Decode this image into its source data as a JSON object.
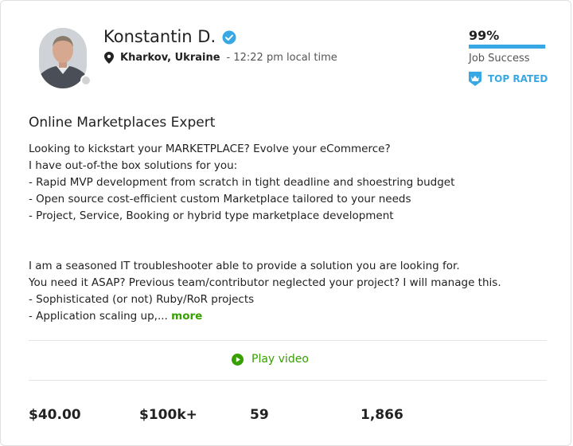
{
  "profile": {
    "name": "Konstantin D.",
    "location": "Kharkov, Ukraine",
    "local_time": "- 12:22 pm local time",
    "title": "Online Marketplaces Expert"
  },
  "job_success": {
    "percent_label": "99%",
    "value": 99,
    "label": "Job Success"
  },
  "badge": {
    "label": "TOP RATED"
  },
  "description": {
    "lines": [
      "Looking to kickstart your MARKETPLACE? Evolve your eCommerce?",
      "I have out-of-the box solutions for you:",
      "- Rapid MVP development from scratch in tight deadline and shoestring budget",
      "- Open source cost-efficient custom Marketplace tailored to your needs",
      "- Project, Service, Booking or hybrid type marketplace development",
      "I am a seasoned IT troubleshooter able to provide a solution you are looking for.",
      "You need it ASAP? Previous team/contributor neglected your project? I will manage this.",
      "- Sophisticated (or not) Ruby/RoR projects",
      "- Application scaling up,..."
    ],
    "more_label": "more"
  },
  "video": {
    "play_label": "Play video"
  },
  "stats": {
    "rate": "$40.00",
    "earned": "$100k+",
    "jobs": "59",
    "hours": "1,866"
  },
  "colors": {
    "accent_blue": "#37a8e4",
    "accent_green": "#37a000"
  },
  "icons": [
    "verified-icon",
    "location-pin-icon",
    "top-rated-badge-icon",
    "play-icon"
  ]
}
